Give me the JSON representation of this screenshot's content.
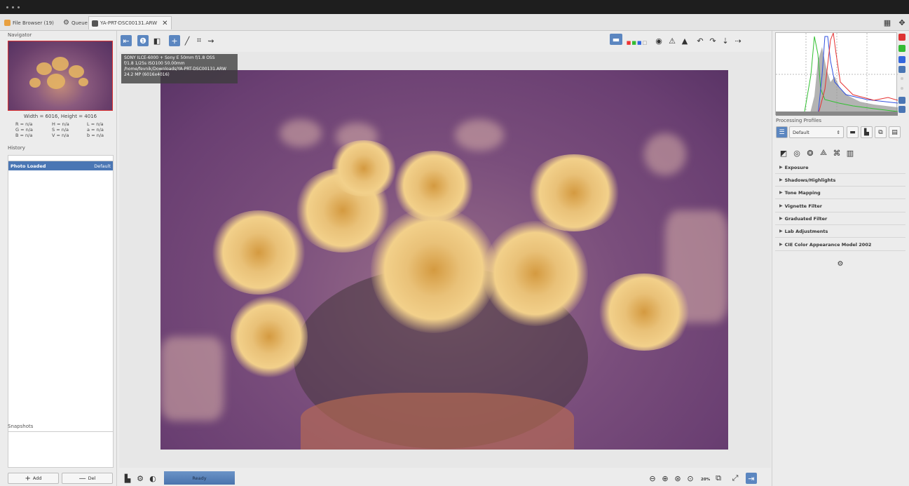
{
  "window": {
    "title_dots": 3
  },
  "tabs": [
    {
      "label": "File Browser (19)",
      "icon": "folder-icon"
    },
    {
      "label": "Queue",
      "icon": "gears-icon"
    },
    {
      "label": "YA-PRT-DSC00131.ARW",
      "icon": "image-icon"
    }
  ],
  "tab_close": "✕",
  "navigator": {
    "title": "Navigator",
    "dimensions": "Width = 6016, Height = 4016",
    "readout": {
      "rgb": [
        "R = n/a",
        "G = n/a",
        "B = n/a"
      ],
      "hsv": [
        "H = n/a",
        "S = n/a",
        "V = n/a"
      ],
      "lab": [
        "L = n/a",
        "a = n/a",
        "b = n/a"
      ]
    }
  },
  "history": {
    "title": "History",
    "rows": [
      {
        "label": "Photo Loaded",
        "value": "Default"
      }
    ]
  },
  "snapshots": {
    "title": "Snapshots",
    "add_label": "Add",
    "del_label": "Del"
  },
  "exif": {
    "line1": "SONY ILCE-6000 + Sony E 50mm f/1.8 OSS",
    "line2": "f/1.8  1/25s  ISO100  50.00mm",
    "line3": "/home/fevnik/Downloads/YA-PRT-DSC00131.ARW",
    "line4": "24.2 MP (6016x4016)"
  },
  "status": {
    "ready": "Ready"
  },
  "zoom": {
    "level": "20%"
  },
  "processing_profiles": {
    "title": "Processing Profiles",
    "selected": "Default"
  },
  "tools": [
    "Exposure",
    "Shadows/Highlights",
    "Tone Mapping",
    "Vignette Filter",
    "Graduated Filter",
    "Lab Adjustments",
    "CIE Color Appearance Model 2002"
  ],
  "colors": {
    "accent": "#4a76b4",
    "titlebar": "#1e1e1e",
    "histo_red": "#e53030",
    "histo_green": "#30c030",
    "histo_blue": "#3050e0"
  }
}
